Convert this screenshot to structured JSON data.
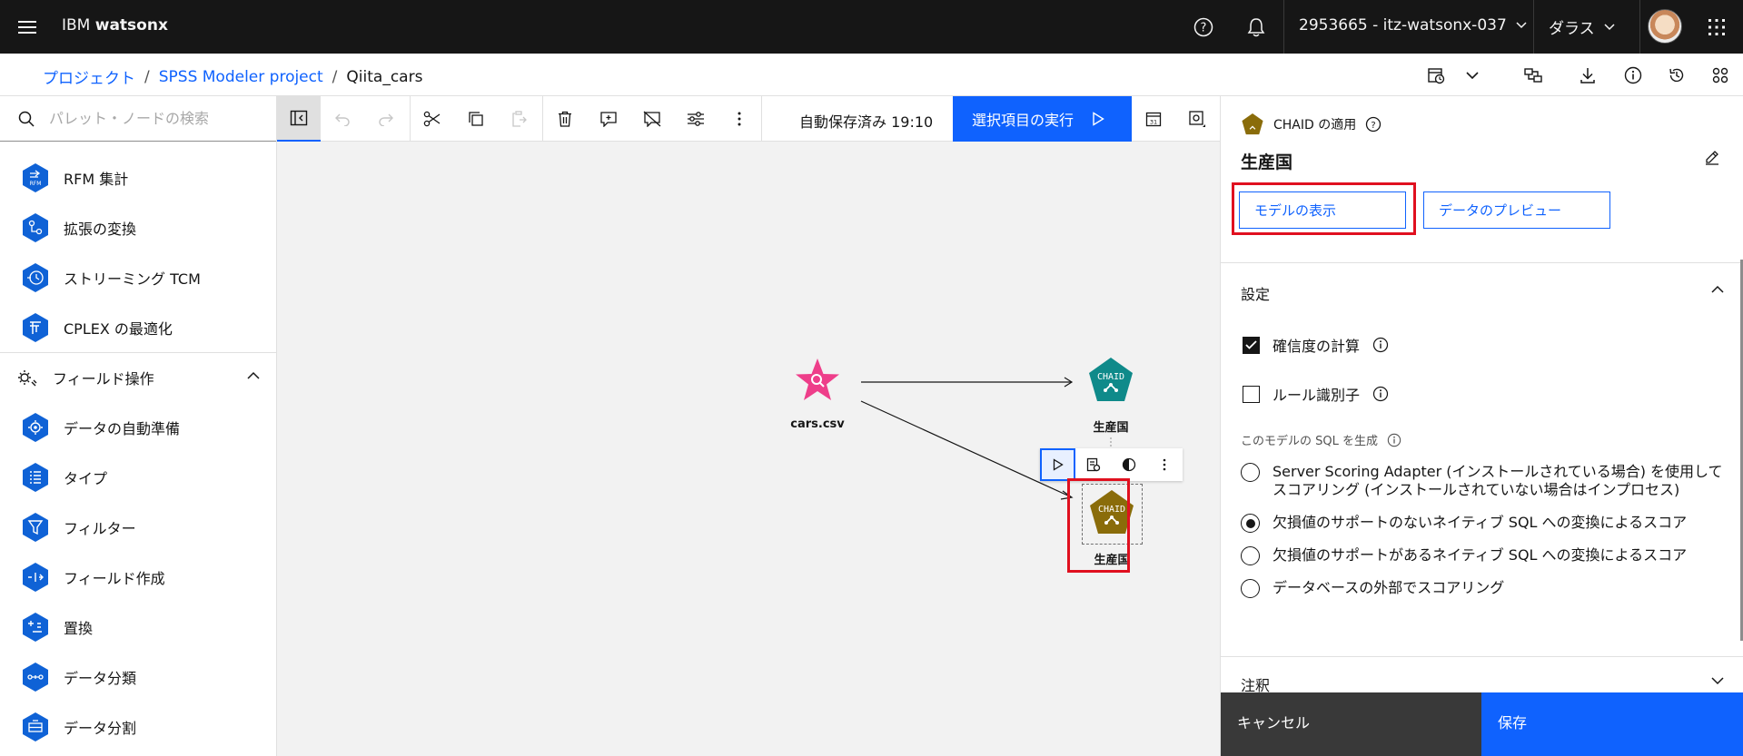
{
  "header": {
    "brand_prefix": "IBM ",
    "brand_name": "watsonx",
    "account": "2953665 - itz-watsonx-037",
    "region": "ダラス"
  },
  "breadcrumb": {
    "items": [
      "プロジェクト",
      "SPSS Modeler project"
    ],
    "current": "Qiita_cars",
    "separator": "/"
  },
  "palette": {
    "search_placeholder": "パレット・ノードの検索",
    "items_top": [
      {
        "label": "RFM 集計",
        "icon": "rfm-icon"
      },
      {
        "label": "拡張の変換",
        "icon": "extension-transform-icon"
      },
      {
        "label": "ストリーミング TCM",
        "icon": "streaming-tcm-icon"
      },
      {
        "label": "CPLEX の最適化",
        "icon": "cplex-icon"
      }
    ],
    "section": "フィールド操作",
    "items_section": [
      {
        "label": "データの自動準備",
        "icon": "auto-data-prep-icon"
      },
      {
        "label": "タイプ",
        "icon": "type-icon"
      },
      {
        "label": "フィルター",
        "icon": "filter-icon"
      },
      {
        "label": "フィールド作成",
        "icon": "derive-icon"
      },
      {
        "label": "置換",
        "icon": "filler-icon"
      },
      {
        "label": "データ分類",
        "icon": "binning-icon"
      },
      {
        "label": "データ分割",
        "icon": "partition-icon"
      }
    ]
  },
  "toolbar": {
    "autosave": "自動保存済み 19:10",
    "run_label": "選択項目の実行"
  },
  "canvas": {
    "nodes": [
      {
        "id": "source",
        "label": "cars.csv"
      },
      {
        "id": "model",
        "label": "生産国",
        "badge": "CHAID"
      },
      {
        "id": "apply",
        "label": "生産国",
        "badge": "CHAID"
      }
    ]
  },
  "panel": {
    "subtitle": "CHAID の適用",
    "title": "生産国",
    "view_model_label": "モデルの表示",
    "preview_label": "データのプレビュー",
    "settings_title": "設定",
    "checkbox_confidence": "確信度の計算",
    "checkbox_rule_id": "ルール識別子",
    "sql_label": "このモデルの SQL を生成",
    "radio_options": [
      "Server Scoring Adapter (インストールされている場合) を使用してスコアリング (インストールされていない場合はインプロセス)",
      "欠損値のサポートのないネイティブ SQL への変換によるスコア",
      "欠損値のサポートがあるネイティブ SQL への変換によるスコア",
      "データベースの外部でスコアリング"
    ],
    "selected_radio": 1,
    "annotation_title": "注釈",
    "cancel_label": "キャンセル",
    "save_label": "保存"
  },
  "colors": {
    "primary": "#0f62fe",
    "header_bg": "#161616",
    "node_blue": "#0f62d6",
    "source_pink": "#ee3e8a",
    "model_teal": "#0f8a8a",
    "apply_gold": "#8a6c0a",
    "highlight_red": "#e0101f"
  }
}
